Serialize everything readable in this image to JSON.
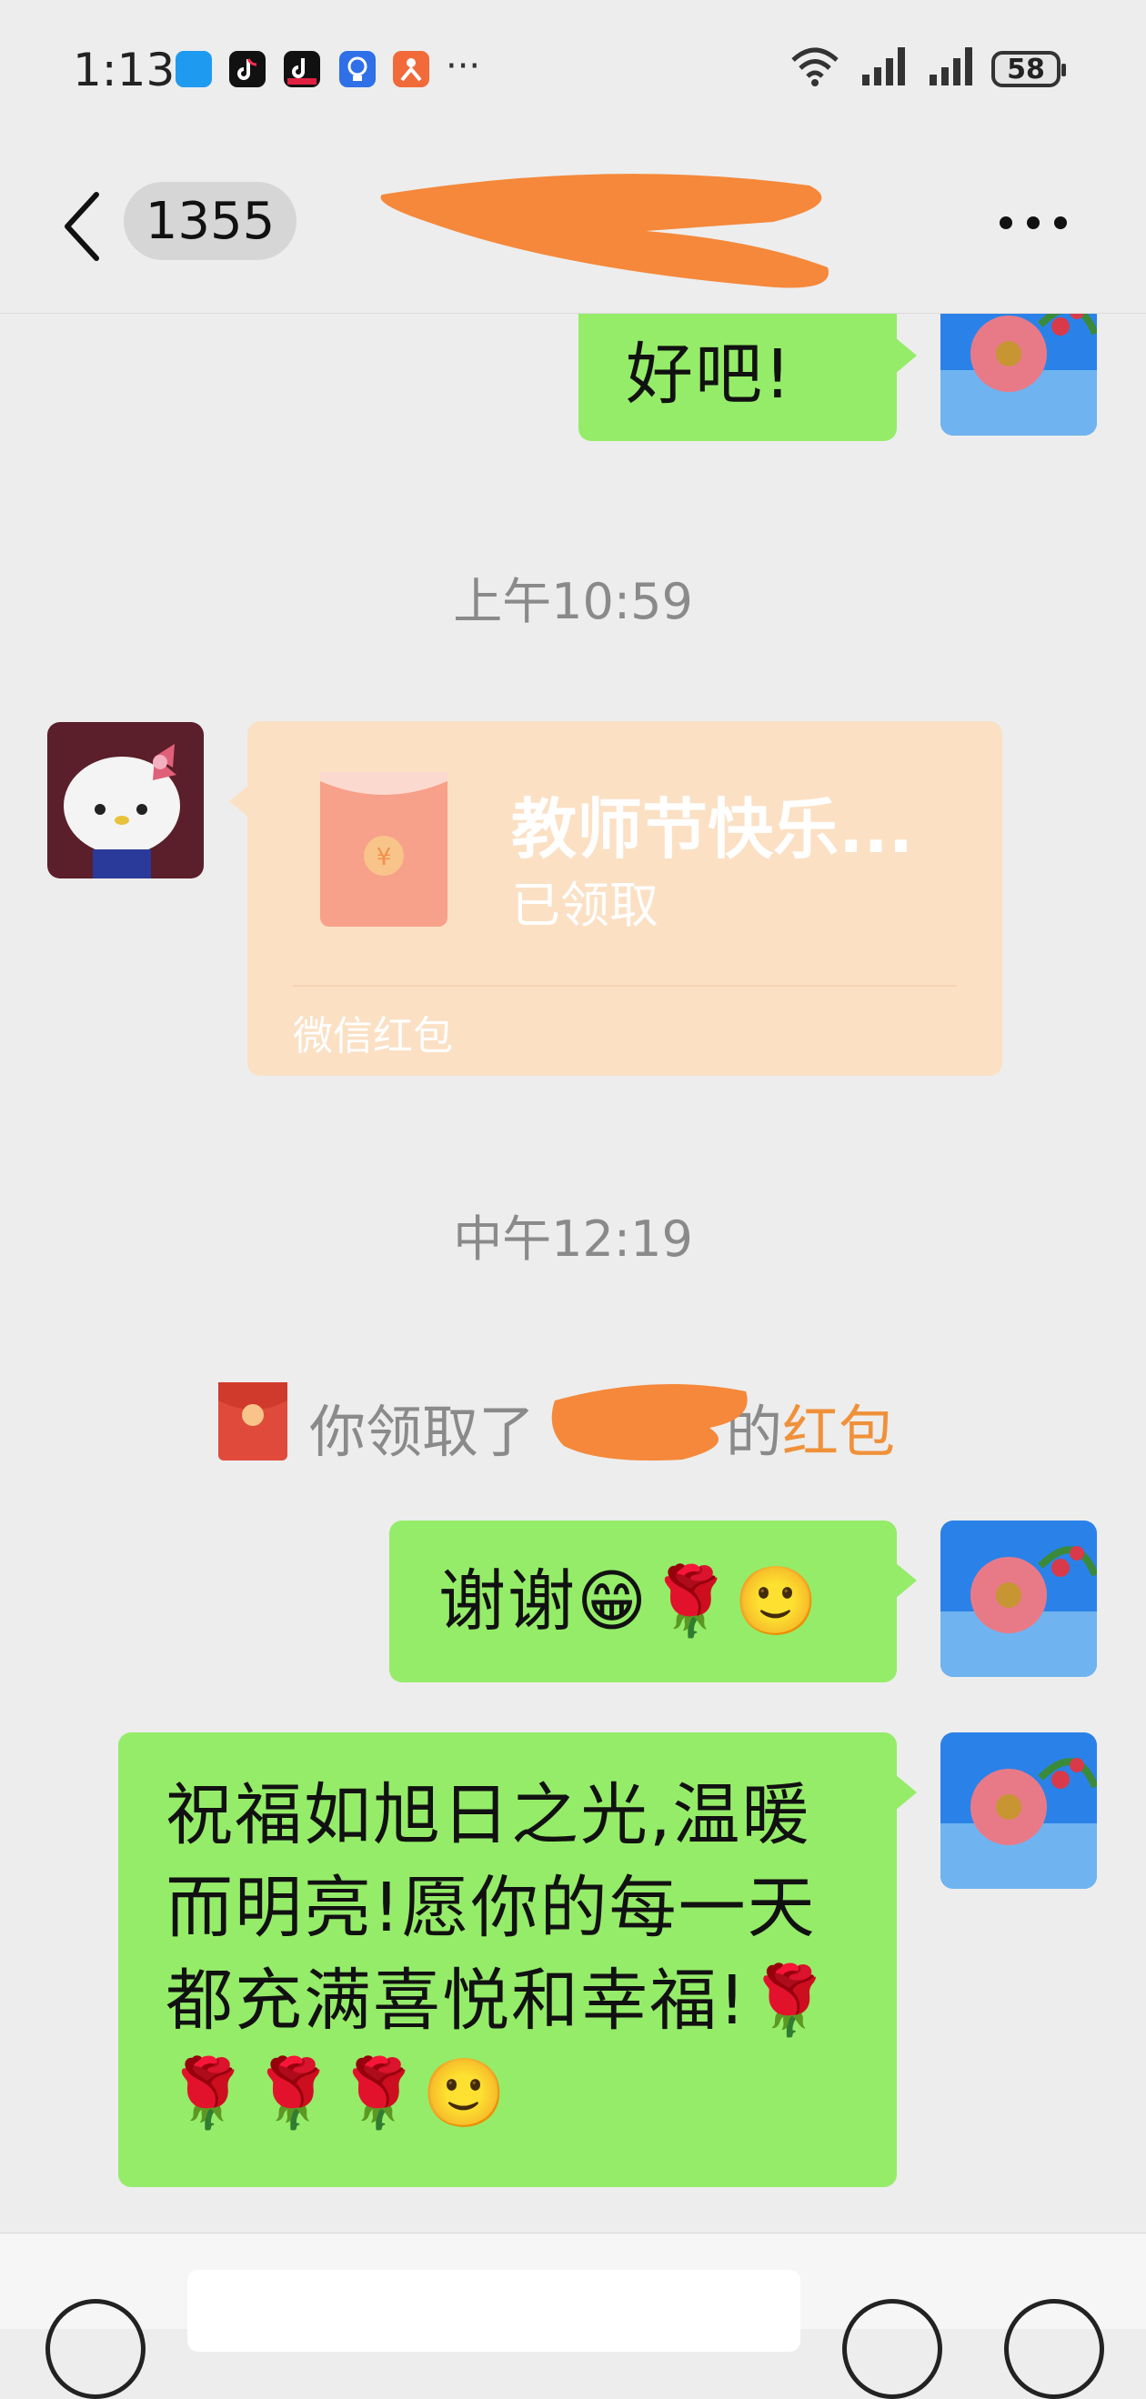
{
  "status_bar": {
    "time": "1:13",
    "notification_icons": [
      "message-app-icon",
      "tiktok-icon",
      "tiktok-lite-icon",
      "idea-app-icon",
      "orange-app-icon"
    ],
    "more": "···",
    "battery": "58"
  },
  "nav": {
    "unread_count": "1355",
    "title": ""
  },
  "messages": {
    "m1_text": "好吧!",
    "time1": "上午10:59",
    "red_packet": {
      "title": "教师节快乐...",
      "status": "已领取",
      "footer": "微信红包"
    },
    "time2": "中午12:19",
    "system": {
      "prefix": "你领取了",
      "suffix": "的",
      "link": "红包"
    },
    "m2_text": "谢谢😁🌹🙂",
    "m3_text": "祝福如旭日之光,温暖而明亮!愿你的每一天都充满喜悦和幸福!🌹🌹🌹🌹🙂"
  },
  "colors": {
    "background": "#ededed",
    "outgoing_bubble": "#95ec69",
    "red_packet_bg": "#fbe0c4",
    "link": "#f0913a",
    "redaction": "#f5883a"
  }
}
